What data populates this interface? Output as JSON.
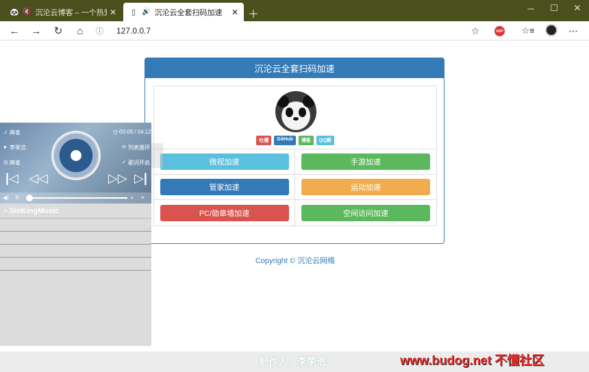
{
  "browser": {
    "tabs": [
      {
        "title": "沉沦云博客 – 一个热爱生活",
        "active": false
      },
      {
        "title": "沉沦云全套扫码加速",
        "active": true
      }
    ],
    "url": "127.0.0.7"
  },
  "panel": {
    "heading": "沉沦云全套扫码加速",
    "badges": [
      {
        "label": "吐槽",
        "color": "#d9534f"
      },
      {
        "label": "GitHub",
        "color": "#337ab7"
      },
      {
        "label": "博客",
        "color": "#5cb85c"
      },
      {
        "label": "QQ群",
        "color": "#5bc0de"
      }
    ],
    "buttons": [
      {
        "label": "微视加速",
        "color": "#5bc0de"
      },
      {
        "label": "手游加速",
        "color": "#5cb85c"
      },
      {
        "label": "管家加速",
        "color": "#337ab7"
      },
      {
        "label": "运动加速",
        "color": "#f0ad4e"
      },
      {
        "label": "PC/勋章墙加速",
        "color": "#d9534f"
      },
      {
        "label": "空间访问加速",
        "color": "#5cb85c"
      }
    ]
  },
  "copyright": "Copyright © 沉沦云网络",
  "player": {
    "song": "麻雀",
    "time": "00:09 / 04:12",
    "artist": "李荣浩",
    "loop_mode": "列表循环",
    "album": "麻雀",
    "lyrics_status": "歌词开启",
    "progress": 0.036,
    "list_title": "SinKingMusic"
  },
  "footer": {
    "author": "制作人：李荣浩",
    "watermark": "www.budog.net 不懂社区"
  }
}
